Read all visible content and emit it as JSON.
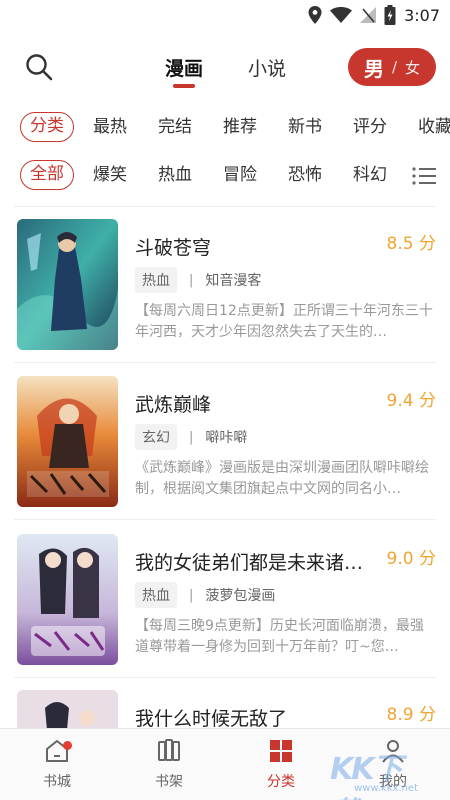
{
  "status_bar": {
    "time": "3:07"
  },
  "header": {
    "tabs": [
      {
        "label": "漫画"
      },
      {
        "label": "小说"
      }
    ],
    "gender": {
      "male": "男",
      "separator": "/",
      "female": "女"
    }
  },
  "filter_sort": [
    "分类",
    "最热",
    "完结",
    "推荐",
    "新书",
    "评分",
    "收藏"
  ],
  "filter_genre": [
    "全部",
    "爆笑",
    "热血",
    "冒险",
    "恐怖",
    "科幻"
  ],
  "books": [
    {
      "title": "斗破苍穹",
      "score": "8.5 分",
      "genre": "热血",
      "author": "知音漫客",
      "desc": "【每周六周日12点更新】正所谓三十年河东三十年河西，天才少年因忽然失去了天生的…"
    },
    {
      "title": "武炼巅峰",
      "score": "9.4 分",
      "genre": "玄幻",
      "author": "噼咔噼",
      "desc": "《武炼巅峰》漫画版是由深圳漫画团队噼咔噼绘制，根据阅文集团旗起点中文网的同名小…"
    },
    {
      "title": "我的女徒弟们都是未来诸…",
      "score": "9.0 分",
      "genre": "热血",
      "author": "菠萝包漫画",
      "desc": "【每周三晚9点更新】历史长河面临崩溃，最强道尊带着一身修为回到十万年前？叮~您…"
    },
    {
      "title": "我什么时候无敌了",
      "score": "8.9 分"
    }
  ],
  "bottom_nav": [
    {
      "label": "书城"
    },
    {
      "label": "书架"
    },
    {
      "label": "分类"
    },
    {
      "label": "我的"
    }
  ],
  "watermark": {
    "text": "KK下载",
    "sub": "www.kkx.net"
  },
  "colors": {
    "accent": "#c8372d",
    "score": "#f0a531"
  }
}
